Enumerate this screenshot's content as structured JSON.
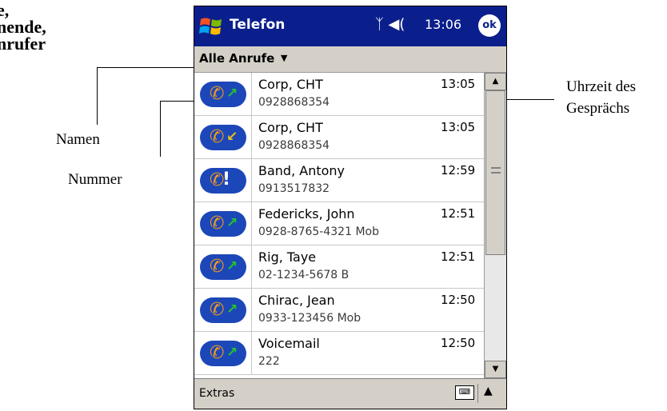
{
  "heading": {
    "lines": [
      "e,",
      "nende,",
      "nrufer"
    ]
  },
  "annotations": {
    "names": "Namen",
    "number": "Nummer",
    "time_line1": "Uhrzeit des",
    "time_line2": "Gesprächs"
  },
  "titlebar": {
    "app_title": "Telefon",
    "status_icons": "ᛉ ◀(",
    "time": "13:06",
    "ok_label": "ok",
    "accent": "#0b1f8c"
  },
  "filter": {
    "label": "Alle Anrufe",
    "caret": "▼"
  },
  "calls": [
    {
      "name": "Corp, CHT",
      "number": "0928868354",
      "time": "13:05",
      "icon": "outgoing-call-icon"
    },
    {
      "name": "Corp, CHT",
      "number": "0928868354",
      "time": "13:05",
      "icon": "incoming-call-icon"
    },
    {
      "name": "Band, Antony",
      "number": "0913517832",
      "time": "12:59",
      "icon": "missed-call-icon"
    },
    {
      "name": "Federicks, John",
      "number": "0928-8765-4321 Mob",
      "time": "12:51",
      "icon": "outgoing-call-icon"
    },
    {
      "name": "Rig, Taye",
      "number": "02-1234-5678 B",
      "time": "12:51",
      "icon": "outgoing-call-icon"
    },
    {
      "name": "Chirac, Jean",
      "number": "0933-123456 Mob",
      "time": "12:50",
      "icon": "outgoing-call-icon"
    },
    {
      "name": "Voicemail",
      "number": "222",
      "time": "12:50",
      "icon": "outgoing-call-icon"
    }
  ],
  "menubar": {
    "extras_label": "Extras",
    "keyboard_icon": "⌨",
    "sip_arrow": "▲"
  },
  "scrollbar": {
    "up": "▲",
    "down": "▼"
  }
}
